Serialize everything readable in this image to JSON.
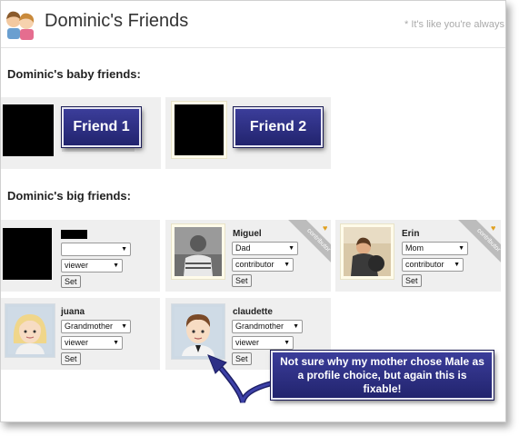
{
  "header": {
    "title": "Dominic's Friends",
    "tagline": "* It's like you're always s"
  },
  "sections": {
    "baby_heading": "Dominic's baby friends:",
    "big_heading": "Dominic's big friends:"
  },
  "baby_friends": [
    {
      "label": "Friend 1"
    },
    {
      "label": "Friend 2"
    }
  ],
  "big_friends": [
    {
      "name": "",
      "relation": "",
      "role": "viewer",
      "set_label": "Set",
      "contributor_badge": ""
    },
    {
      "name": "Miguel",
      "relation": "Dad",
      "role": "contributor",
      "set_label": "Set",
      "contributor_badge": "contributor"
    },
    {
      "name": "Erin",
      "relation": "Mom",
      "role": "contributor",
      "set_label": "Set",
      "contributor_badge": "contributor"
    },
    {
      "name": "juana",
      "relation": "Grandmother",
      "role": "viewer",
      "set_label": "Set",
      "contributor_badge": ""
    },
    {
      "name": "claudette",
      "relation": "Grandmother",
      "role": "viewer",
      "set_label": "Set",
      "contributor_badge": ""
    }
  ],
  "annotation": {
    "text": "Not sure why my mother chose Male as a profile choice, but again this is fixable!"
  },
  "icons": {
    "dropdown": "chevron-down-icon",
    "favorite": "heart-icon"
  },
  "colors": {
    "callout_bg": "#2d2f86",
    "card_bg": "#efefef",
    "ribbon": "#bcbcbc"
  }
}
